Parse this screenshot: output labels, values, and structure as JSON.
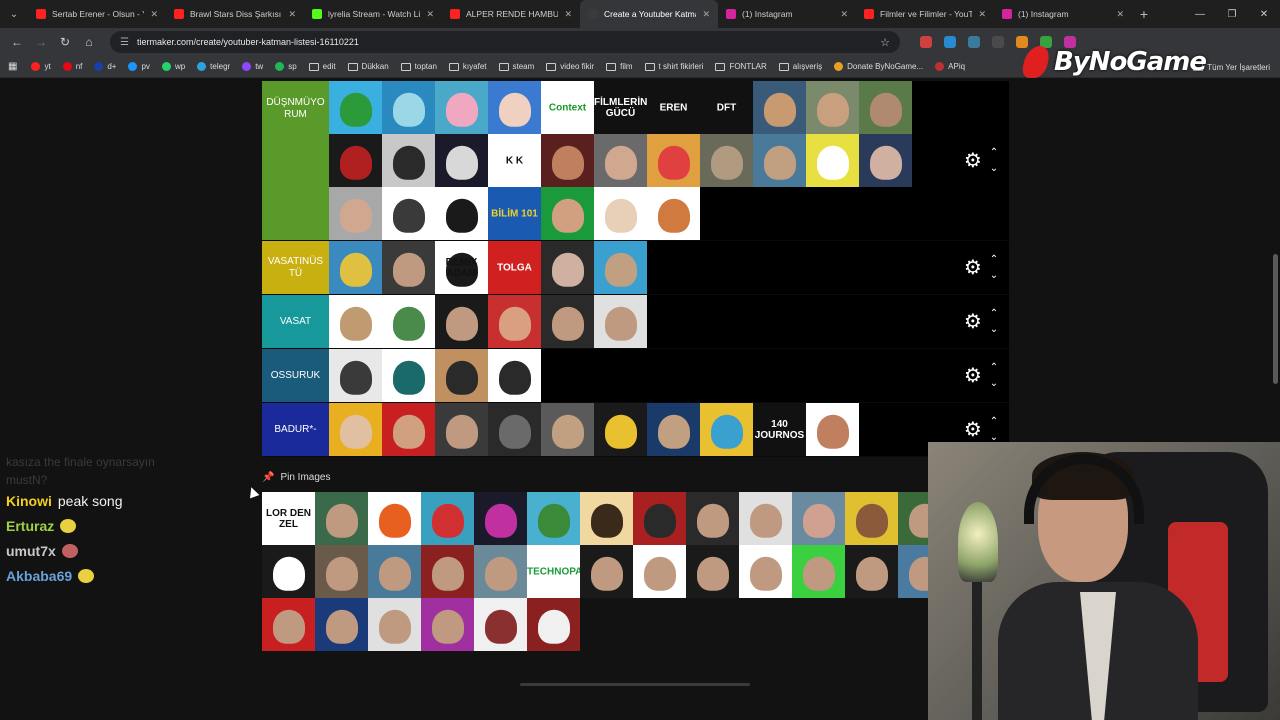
{
  "browser": {
    "tabs": [
      {
        "title": "Sertab Erener - Olsun - Yo",
        "color": "#ff2020",
        "active": false
      },
      {
        "title": "Brawl Stars Diss Şarkısı | Y",
        "color": "#ff2020",
        "active": false
      },
      {
        "title": "lyrelia Stream - Watch Liv",
        "color": "#53fc18",
        "active": false
      },
      {
        "title": "ALPER RENDE HAMBURG",
        "color": "#ff2020",
        "active": false
      },
      {
        "title": "Create a Youtuber Katman",
        "color": "#3a3a3a",
        "active": true
      },
      {
        "title": "(1) Instagram",
        "color": "#d6249f",
        "active": false
      },
      {
        "title": "Filmler ve Filimler - YouTu",
        "color": "#ff2020",
        "active": false
      },
      {
        "title": "(1) Instagram",
        "color": "#d6249f",
        "active": false
      }
    ],
    "url": "tiermaker.com/create/youtuber-katman-listesi-16110221",
    "bookmarks": [
      {
        "label": "yt",
        "icon": "youtube-icon",
        "color": "#ff2020"
      },
      {
        "label": "nf",
        "icon": "netflix-icon",
        "color": "#e50914"
      },
      {
        "label": "d+",
        "icon": "disney-icon",
        "color": "#1a3fa8"
      },
      {
        "label": "pv",
        "icon": "prime-icon",
        "color": "#1a98ff"
      },
      {
        "label": "wp",
        "icon": "whatsapp-icon",
        "color": "#25d366"
      },
      {
        "label": "telegr",
        "icon": "telegram-icon",
        "color": "#2aa3e0"
      },
      {
        "label": "tw",
        "icon": "twitch-icon",
        "color": "#9146ff"
      },
      {
        "label": "sp",
        "icon": "spotify-icon",
        "color": "#1db954"
      },
      {
        "label": "edit",
        "icon": "folder-icon",
        "color": ""
      },
      {
        "label": "Dükkan",
        "icon": "folder-icon",
        "color": ""
      },
      {
        "label": "toptan",
        "icon": "folder-icon",
        "color": ""
      },
      {
        "label": "kıyafet",
        "icon": "folder-icon",
        "color": ""
      },
      {
        "label": "steam",
        "icon": "folder-icon",
        "color": ""
      },
      {
        "label": "video fikir",
        "icon": "folder-icon",
        "color": ""
      },
      {
        "label": "film",
        "icon": "folder-icon",
        "color": ""
      },
      {
        "label": "t shirt fikirleri",
        "icon": "folder-icon",
        "color": ""
      },
      {
        "label": "FONTLAR",
        "icon": "folder-icon",
        "color": ""
      },
      {
        "label": "alışveriş",
        "icon": "folder-icon",
        "color": ""
      },
      {
        "label": "Donate ByNoGame...",
        "icon": "bynogame-icon",
        "color": "#e8a020"
      },
      {
        "label": "APiq",
        "icon": "apiq-icon",
        "color": "#c03030"
      }
    ],
    "bookmarks_all": "Tüm Yer İşaretleri"
  },
  "watermark": "ByNoGame",
  "tiers": [
    {
      "label": "DÜŞNMÜYORUM",
      "label_display": "DÜŞNMÜYO RUM",
      "color": "#5a9a2a",
      "tiles": [
        {
          "bg": "#3ab0e0",
          "fg": "#2a9a3a",
          "text": ""
        },
        {
          "bg": "#2a8ac0",
          "fg": "#9ad8e8",
          "text": ""
        },
        {
          "bg": "#4aa8c8",
          "fg": "#f0a8c0",
          "text": ""
        },
        {
          "bg": "#3a7ad0",
          "fg": "#f0d0c0",
          "text": ""
        },
        {
          "bg": "#ffffff",
          "fg": "",
          "text": "Context",
          "tcolor": "#1a9a2a"
        },
        {
          "bg": "#111111",
          "fg": "",
          "text": "FİLMLERİN GÜCÜ",
          "tcolor": "#ffffff"
        },
        {
          "bg": "#111111",
          "fg": "",
          "text": "EREN",
          "tcolor": "#ffffff"
        },
        {
          "bg": "#111111",
          "fg": "",
          "text": "DFT",
          "tcolor": "#ffffff"
        },
        {
          "bg": "#3a5a7a",
          "fg": "#c89a70",
          "text": ""
        },
        {
          "bg": "#7a8a6a",
          "fg": "#c8a080",
          "text": ""
        },
        {
          "bg": "#5a7a4a",
          "fg": "#b08a70",
          "text": ""
        },
        {
          "bg": "#1a1a1a",
          "fg": "#b02020",
          "text": ""
        },
        {
          "bg": "#c8c8c8",
          "fg": "#2a2a2a",
          "text": ""
        },
        {
          "bg": "#1a1a2a",
          "fg": "#d8d8d8",
          "text": ""
        },
        {
          "bg": "#ffffff",
          "fg": "",
          "text": "K K",
          "tcolor": "#111111"
        },
        {
          "bg": "#5a2020",
          "fg": "#c08060",
          "text": ""
        },
        {
          "bg": "#6a6a6a",
          "fg": "#d0a890",
          "text": ""
        },
        {
          "bg": "#e0a040",
          "fg": "#e04040",
          "text": ""
        },
        {
          "bg": "#6a6a5a",
          "fg": "#b09a80",
          "text": ""
        },
        {
          "bg": "#4a7a9a",
          "fg": "#c0a080",
          "text": ""
        },
        {
          "bg": "#e8e040",
          "fg": "#ffffff",
          "text": ""
        },
        {
          "bg": "#2a3a5a",
          "fg": "#d0b0a0",
          "text": ""
        },
        {
          "bg": "#a8a8a8",
          "fg": "#d0a890",
          "text": ""
        },
        {
          "bg": "#ffffff",
          "fg": "#3a3a3a",
          "text": ""
        },
        {
          "bg": "#ffffff",
          "fg": "#1a1a1a",
          "text": ""
        },
        {
          "bg": "#1a5ab0",
          "fg": "",
          "text": "BİLİM 101",
          "tcolor": "#f0d030"
        },
        {
          "bg": "#1a9a3a",
          "fg": "#d0a080",
          "text": ""
        },
        {
          "bg": "#ffffff",
          "fg": "#e8d0b8",
          "text": ""
        },
        {
          "bg": "#ffffff",
          "fg": "#d07a40",
          "text": ""
        }
      ]
    },
    {
      "label": "VASATINÜSTÜ",
      "label_display": "VASATINÜS TÜ",
      "color": "#c8b010",
      "tiles": [
        {
          "bg": "#3a8ac0",
          "fg": "#e0c040",
          "text": ""
        },
        {
          "bg": "#3a3a3a",
          "fg": "#c09a80",
          "text": ""
        },
        {
          "bg": "#ffffff",
          "fg": "#1a1a1a",
          "text": "REMIX ADAM",
          "tcolor": "#111111"
        },
        {
          "bg": "#d02020",
          "fg": "",
          "text": "TOLGA",
          "tcolor": "#ffffff"
        },
        {
          "bg": "#2a2a2a",
          "fg": "#d0b0a0",
          "text": ""
        },
        {
          "bg": "#3aa0d0",
          "fg": "#c0a080",
          "text": ""
        }
      ]
    },
    {
      "label": "VASAT",
      "label_display": "VASAT",
      "color": "#17989a",
      "tiles": [
        {
          "bg": "#ffffff",
          "fg": "#c09a70",
          "text": ""
        },
        {
          "bg": "#ffffff",
          "fg": "#4a8a4a",
          "text": ""
        },
        {
          "bg": "#1a1a1a",
          "fg": "#c09a80",
          "text": ""
        },
        {
          "bg": "#c83030",
          "fg": "#d8a080",
          "text": ""
        },
        {
          "bg": "#2a2a2a",
          "fg": "#c09a80",
          "text": ""
        },
        {
          "bg": "#e0e0e0",
          "fg": "#c09a80",
          "text": ""
        }
      ]
    },
    {
      "label": "OSSURUK",
      "label_display": "OSSURUK",
      "color": "#1a5a7a",
      "tiles": [
        {
          "bg": "#e8e8e8",
          "fg": "#3a3a3a",
          "text": ""
        },
        {
          "bg": "#ffffff",
          "fg": "#1a6a6a",
          "text": ""
        },
        {
          "bg": "#c09060",
          "fg": "#2a2a2a",
          "text": ""
        },
        {
          "bg": "#ffffff",
          "fg": "#2a2a2a",
          "text": ""
        }
      ]
    },
    {
      "label": "BADUR*-",
      "label_display": "BADUR*-",
      "color": "#1a2a9a",
      "tiles": [
        {
          "bg": "#e8b020",
          "fg": "#e0c0a0",
          "text": ""
        },
        {
          "bg": "#c82020",
          "fg": "#d0a080",
          "text": ""
        },
        {
          "bg": "#3a3a3a",
          "fg": "#c09a80",
          "text": ""
        },
        {
          "bg": "#2a2a2a",
          "fg": "#6a6a6a",
          "text": ""
        },
        {
          "bg": "#5a5a5a",
          "fg": "#c0a080",
          "text": ""
        },
        {
          "bg": "#1a1a1a",
          "fg": "#e8c030",
          "text": ""
        },
        {
          "bg": "#1a3a6a",
          "fg": "#c0a080",
          "text": ""
        },
        {
          "bg": "#e8c030",
          "fg": "#3aa0d0",
          "text": ""
        },
        {
          "bg": "#111111",
          "fg": "",
          "text": "140 JOURNOS",
          "tcolor": "#ffffff"
        },
        {
          "bg": "#ffffff",
          "fg": "#c08060",
          "text": ""
        }
      ]
    }
  ],
  "pin_section": {
    "title": "Pin Images"
  },
  "pinned_tiles": [
    {
      "bg": "#ffffff",
      "fg": "",
      "text": "LOR DEN ZEL",
      "tcolor": "#111111"
    },
    {
      "bg": "#3a6a4a",
      "fg": "#c09a80",
      "text": ""
    },
    {
      "bg": "#ffffff",
      "fg": "#e86020",
      "text": ""
    },
    {
      "bg": "#3aa0c0",
      "fg": "#d03030",
      "text": ""
    },
    {
      "bg": "#1a1a2a",
      "fg": "#c030a0",
      "text": ""
    },
    {
      "bg": "#4ab0d0",
      "fg": "#3a8a3a",
      "text": ""
    },
    {
      "bg": "#f0d8a0",
      "fg": "#3a2a1a",
      "text": ""
    },
    {
      "bg": "#a82020",
      "fg": "#2a2a2a",
      "text": ""
    },
    {
      "bg": "#2a2a2a",
      "fg": "#c09a80",
      "text": ""
    },
    {
      "bg": "#e0e0e0",
      "fg": "#c09a80",
      "text": ""
    },
    {
      "bg": "#6a8aa0",
      "fg": "#d0a090",
      "text": ""
    },
    {
      "bg": "#e0c030",
      "fg": "#8a5a3a",
      "text": ""
    },
    {
      "bg": "#3a6a3a",
      "fg": "#c09a80",
      "text": ""
    },
    {
      "bg": "#ffffff",
      "fg": "#d02020",
      "text": ""
    },
    {
      "bg": "#1a1a1a",
      "fg": "#ffffff",
      "text": ""
    },
    {
      "bg": "#6a5a4a",
      "fg": "#c09a80",
      "text": ""
    },
    {
      "bg": "#4a7a9a",
      "fg": "#c09a80",
      "text": ""
    },
    {
      "bg": "#8a2020",
      "fg": "#c09a80",
      "text": ""
    },
    {
      "bg": "#6a8a9a",
      "fg": "#c09a80",
      "text": ""
    },
    {
      "bg": "#ffffff",
      "fg": "",
      "text": "TECHNOPAT",
      "tcolor": "#1a9a3a"
    },
    {
      "bg": "#1a1a1a",
      "fg": "#c09a80",
      "text": ""
    },
    {
      "bg": "#ffffff",
      "fg": "#c09a80",
      "text": ""
    },
    {
      "bg": "#1a1a1a",
      "fg": "#c09a80",
      "text": ""
    },
    {
      "bg": "#ffffff",
      "fg": "#c09a80",
      "text": ""
    },
    {
      "bg": "#3ad040",
      "fg": "#c09a80",
      "text": ""
    },
    {
      "bg": "#1a1a1a",
      "fg": "#c09a80",
      "text": ""
    },
    {
      "bg": "#4a7aa0",
      "fg": "#c09a80",
      "text": ""
    },
    {
      "bg": "#1a1a1a",
      "fg": "#c09a80",
      "text": ""
    },
    {
      "bg": "#c82020",
      "fg": "#c09a80",
      "text": ""
    },
    {
      "bg": "#1a3a7a",
      "fg": "#c09a80",
      "text": ""
    },
    {
      "bg": "#e0e0e0",
      "fg": "#c09a80",
      "text": ""
    },
    {
      "bg": "#a030a0",
      "fg": "#c09a80",
      "text": ""
    },
    {
      "bg": "#f0f0f0",
      "fg": "#8a3030",
      "text": ""
    },
    {
      "bg": "#8a2020",
      "fg": "#f0f0f0",
      "text": ""
    }
  ],
  "chat": {
    "ghost_lines": [
      "kasıza the finale oynarsayın",
      "mustN?"
    ],
    "lines": [
      {
        "user": "Kinowi",
        "user_color": "#f0d020",
        "message": "peak song",
        "emote": ""
      },
      {
        "user": "Erturaz",
        "user_color": "#a0d040",
        "message": "",
        "emote": "#e8d040"
      },
      {
        "user": "umut7x",
        "user_color": "#c8c8c8",
        "message": "",
        "emote": "#c06060"
      },
      {
        "user": "Akbaba69",
        "user_color": "#6aa0d8",
        "message": "",
        "emote": "#e8d040"
      }
    ]
  }
}
